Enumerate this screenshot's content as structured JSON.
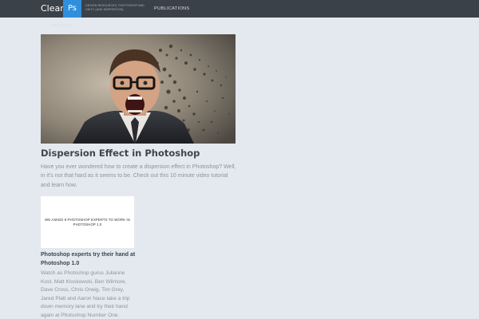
{
  "header": {
    "brand": "Clear",
    "logo_text": "Ps",
    "tagline": "Design resources, Photoshop and Unity (And Inspiration)",
    "nav": [
      "PUBLICATIONS"
    ],
    "ghost_link": "PHOTOSHOP"
  },
  "featured": {
    "image_alt": "man screaming dispersion effect",
    "title": "Dispersion Effect in Photoshop",
    "excerpt": "Have you ever wondered how to create a dispersion effect in Photoshop? Well, in it's not that hard as it seems to be. Check out this 10 minute video tutorial and learn how."
  },
  "card": {
    "thumb_text": "WE ASKED 8 PHOTOSHOP EXPERTS TO WORK IN PHOTOSHOP 1.0",
    "title": "Photoshop experts try their hand at Photoshop 1.0",
    "excerpt": "Watch as Photoshop gurus Julianne Kost, Matt Kloskowski, Ben Wilmore, Dave Cross, Chris Orwig, Tim Grey, Jared Platt and Aaron Nace take a trip down memory lane and try their hand again at Photoshop Number One."
  },
  "colors": {
    "page_bg": "#e4e9ef",
    "topbar_bg": "#3b4148",
    "logo_accent": "#2f8fdd"
  }
}
